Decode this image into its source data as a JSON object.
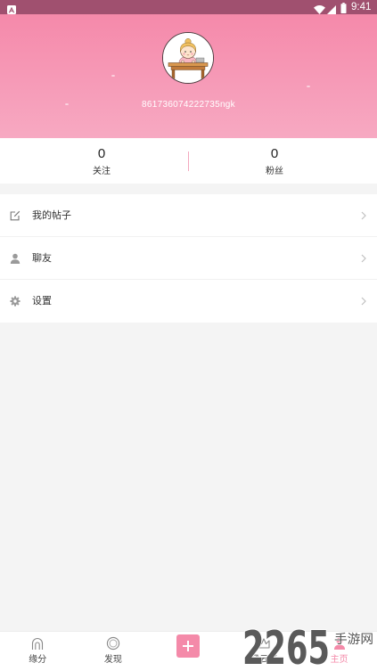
{
  "status_bar": {
    "time": "9:41",
    "icons": [
      "app-notification-icon",
      "wifi-icon",
      "signal-icon",
      "battery-icon"
    ]
  },
  "profile": {
    "avatar": "avatar-girl-at-desk-icon",
    "username": "861736074222735ngk"
  },
  "stats": {
    "following": {
      "value": "0",
      "label": "关注"
    },
    "fans": {
      "value": "0",
      "label": "粉丝"
    }
  },
  "menu": {
    "items": [
      {
        "label": "我的帖子",
        "icon": "edit-icon"
      },
      {
        "label": "聊友",
        "icon": "person-icon"
      },
      {
        "label": "设置",
        "icon": "gear-icon"
      }
    ],
    "chevron_icon": "chevron-right-icon"
  },
  "tab_bar": {
    "tabs": [
      {
        "label": "缘分",
        "icon": "match-icon",
        "active": false
      },
      {
        "label": "发现",
        "icon": "discover-icon",
        "active": false
      },
      {
        "icon": "plus-icon",
        "active": false
      },
      {
        "label": "风云榜",
        "icon": "ranking-icon",
        "active": false
      },
      {
        "label": "主页",
        "icon": "profile-icon",
        "active": true
      }
    ]
  },
  "colors": {
    "accent": "#f48aa9",
    "header_top": "#f589aa",
    "header_bottom": "#f7a9c2",
    "status_bar": "#a0506f",
    "page_background": "#f4f4f4",
    "text_primary": "#333333"
  },
  "watermark": {
    "main": "2265",
    "sub": "手游网"
  }
}
